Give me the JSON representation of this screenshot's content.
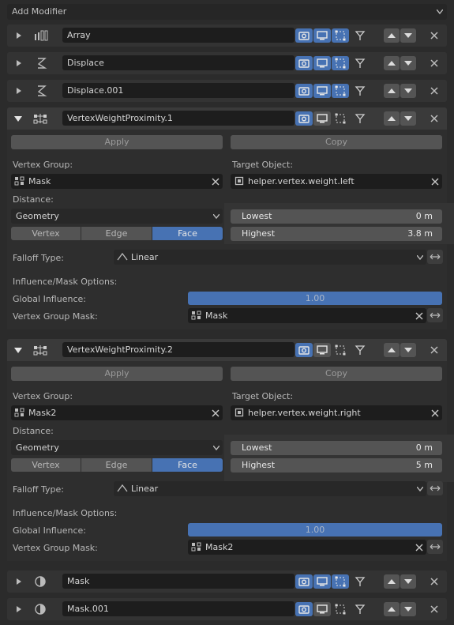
{
  "add_modifier": {
    "label": "Add Modifier"
  },
  "collapsed_top": [
    {
      "name": "Array",
      "icon": "array-modifier-icon"
    },
    {
      "name": "Displace",
      "icon": "displace-modifier-icon"
    },
    {
      "name": "Displace.001",
      "icon": "displace-modifier-icon"
    }
  ],
  "vwp": [
    {
      "name": "VertexWeightProximity.1",
      "apply_label": "Apply",
      "copy_label": "Copy",
      "vertex_group_label": "Vertex Group:",
      "vertex_group_value": "Mask",
      "target_object_label": "Target Object:",
      "target_object_value": "helper.vertex.weight.left",
      "distance_label": "Distance:",
      "distance_value": "Geometry",
      "modes": [
        "Vertex",
        "Edge",
        "Face"
      ],
      "active_mode": "Face",
      "lowest_label": "Lowest",
      "lowest_value": "0 m",
      "highest_label": "Highest",
      "highest_value": "3.8 m",
      "falloff_label": "Falloff Type:",
      "falloff_value": "Linear",
      "influence_section": "Influence/Mask Options:",
      "global_influence_label": "Global Influence:",
      "global_influence_value": "1.00",
      "vg_mask_label": "Vertex Group Mask:",
      "vg_mask_value": "Mask"
    },
    {
      "name": "VertexWeightProximity.2",
      "apply_label": "Apply",
      "copy_label": "Copy",
      "vertex_group_label": "Vertex Group:",
      "vertex_group_value": "Mask2",
      "target_object_label": "Target Object:",
      "target_object_value": "helper.vertex.weight.right",
      "distance_label": "Distance:",
      "distance_value": "Geometry",
      "modes": [
        "Vertex",
        "Edge",
        "Face"
      ],
      "active_mode": "Face",
      "lowest_label": "Lowest",
      "lowest_value": "0 m",
      "highest_label": "Highest",
      "highest_value": "5 m",
      "falloff_label": "Falloff Type:",
      "falloff_value": "Linear",
      "influence_section": "Influence/Mask Options:",
      "global_influence_label": "Global Influence:",
      "global_influence_value": "1.00",
      "vg_mask_label": "Vertex Group Mask:",
      "vg_mask_value": "Mask2"
    }
  ],
  "collapsed_bottom": [
    {
      "name": "Mask",
      "icon": "mask-modifier-icon"
    },
    {
      "name": "Mask.001",
      "icon": "mask-modifier-icon"
    }
  ],
  "colors": {
    "active_blue": "#4772b3",
    "field_dark": "#1d1d1d",
    "button_gray": "#545454"
  }
}
